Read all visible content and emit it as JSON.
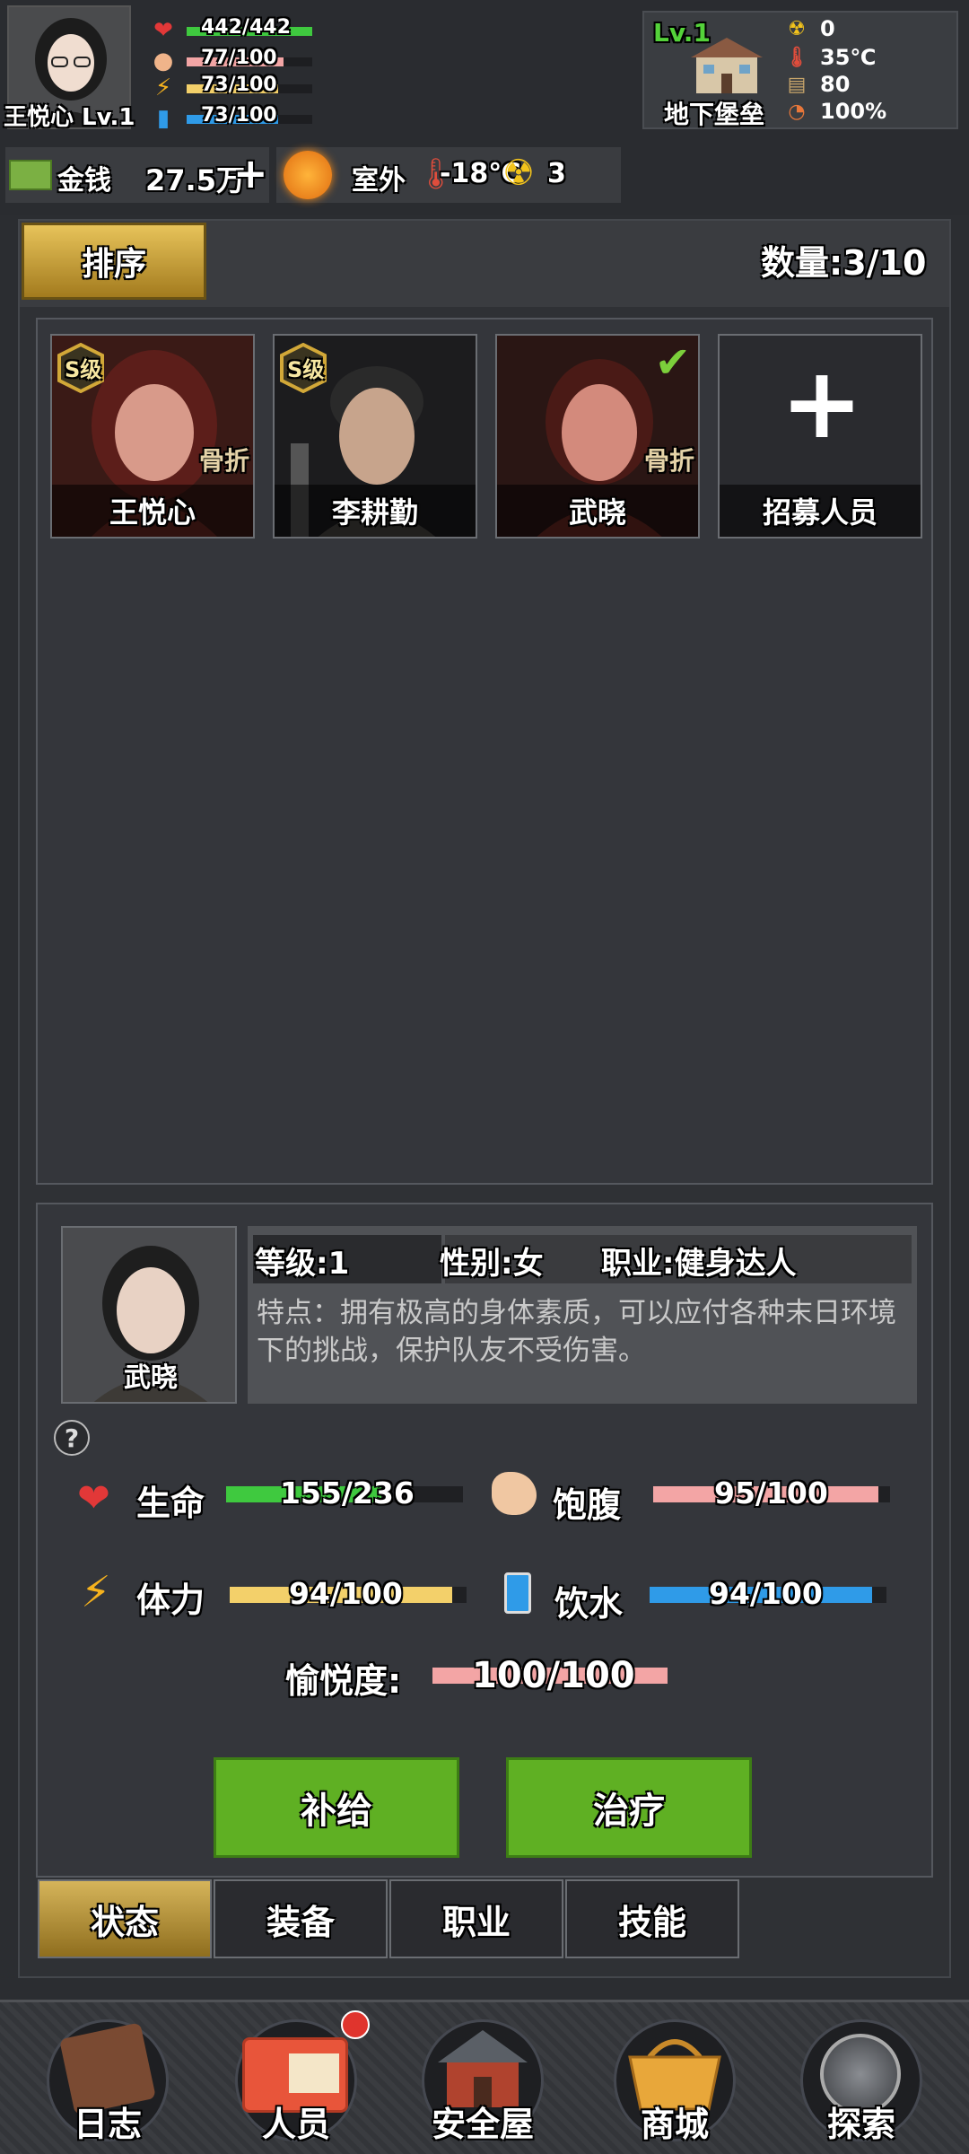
{
  "player": {
    "name": "王悦心 Lv.1",
    "hp": "442/442",
    "hunger": "77/100",
    "stamina": "73/100",
    "thirst": "73/100",
    "hp_frac": 1.0,
    "hunger_frac": 0.77,
    "stamina_frac": 0.73,
    "thirst_frac": 0.73
  },
  "shelter": {
    "level": "Lv.1",
    "name": "地下堡垒",
    "radiation": "0",
    "temperature": "35℃",
    "supplies": "80",
    "integrity": "100%"
  },
  "money": {
    "label": "金钱",
    "value": "27.5万",
    "add": "+"
  },
  "weather": {
    "location": "室外",
    "temperature": "-18℃",
    "radiation": "3"
  },
  "roster": {
    "sort_label": "排序",
    "count": "数量:3/10",
    "members": [
      {
        "name": "王悦心",
        "grade": "S级",
        "status": "骨折"
      },
      {
        "name": "李耕勤",
        "grade": "S级",
        "status": ""
      },
      {
        "name": "武晓",
        "grade": "",
        "status": "骨折",
        "selected": true
      }
    ],
    "recruit_label": "招募人员",
    "recruit_icon": "+"
  },
  "detail": {
    "name": "武晓",
    "level": "等级:1",
    "gender": "性别:女",
    "job": "职业:健身达人",
    "trait": "特点：拥有极高的身体素质，可以应付各种末日环境下的挑战，保护队友不受伤害。",
    "help_icon": "?",
    "life_label": "生命",
    "life": "155/236",
    "life_frac": 0.657,
    "hunger_label": "饱腹",
    "hunger": "95/100",
    "hunger_frac": 0.95,
    "stamina_label": "体力",
    "stamina": "94/100",
    "stamina_frac": 0.94,
    "water_label": "饮水",
    "water": "94/100",
    "water_frac": 0.94,
    "joy_label": "愉悦度:",
    "joy": "100/100",
    "joy_frac": 1.0,
    "supply_btn": "补给",
    "heal_btn": "治疗"
  },
  "tabs": [
    "状态",
    "装备",
    "职业",
    "技能"
  ],
  "nav": [
    "日志",
    "人员",
    "安全屋",
    "商城",
    "探索"
  ],
  "colors": {
    "hp": "#3fc93f",
    "hunger": "#f3a5a5",
    "stamina": "#f3d06a",
    "thirst": "#2f9be8",
    "button_green": "#5fb023",
    "gold": "#d5b45a"
  }
}
